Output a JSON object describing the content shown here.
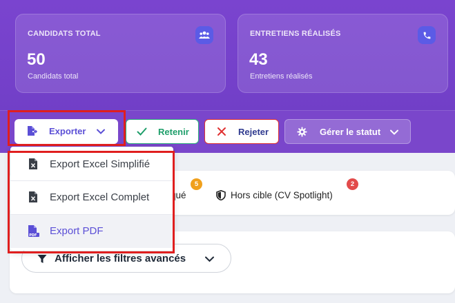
{
  "stats": [
    {
      "title": "CANDIDATS TOTAL",
      "value": "50",
      "subtitle": "Candidats total",
      "icon": "users-icon"
    },
    {
      "title": "ENTRETIENS RÉALISÉS",
      "value": "43",
      "subtitle": "Entretiens réalisés",
      "icon": "phone-icon"
    }
  ],
  "toolbar": {
    "export_label": "Exporter",
    "retain_label": "Retenir",
    "reject_label": "Rejeter",
    "status_label": "Gérer le statut"
  },
  "export_menu": {
    "items": [
      {
        "label": "Export Excel Simplifié",
        "icon": "excel-file-icon"
      },
      {
        "label": "Export Excel Complet",
        "icon": "excel-file-icon"
      },
      {
        "label": "Export PDF",
        "icon": "pdf-file-icon"
      }
    ]
  },
  "tabs": {
    "partial_label": "qué",
    "partial_badge": "5",
    "off_target_label": "Hors cible (CV Spotlight)",
    "off_target_badge": "2"
  },
  "filters": {
    "toggle_label": "Afficher les filtres avancés"
  },
  "colors": {
    "accent": "#5b4fd6",
    "hero": "#7a44cf",
    "success": "#2bb07a",
    "danger": "#e03131",
    "badge_orange": "#f0a01c",
    "badge_red": "#e24b4b"
  }
}
